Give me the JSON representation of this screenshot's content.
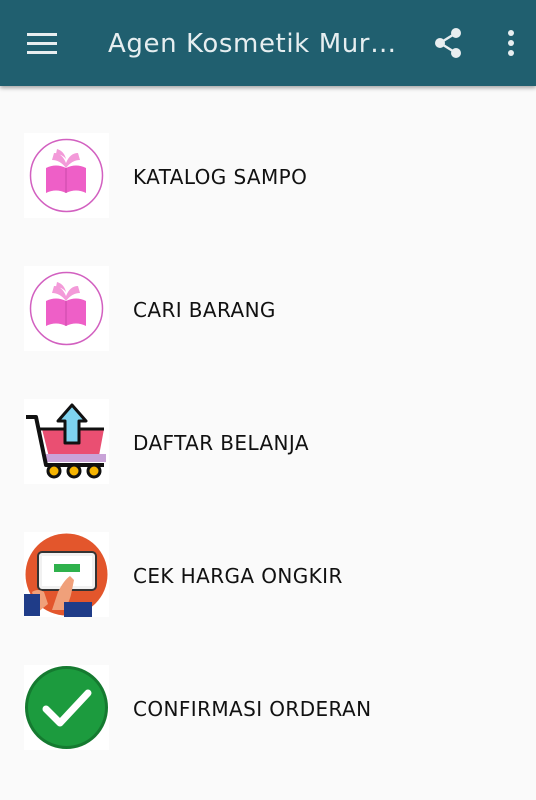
{
  "appbar": {
    "title": "Agen Kosmetik Mur…",
    "menu_icon": "hamburger-menu-icon",
    "share_icon": "share-icon",
    "more_icon": "more-vertical-icon",
    "background_color": "#205f6f"
  },
  "menu": {
    "items": [
      {
        "label": "KATALOG SAMPO",
        "icon": "pink-book-icon"
      },
      {
        "label": "CARI BARANG",
        "icon": "pink-book-icon"
      },
      {
        "label": "DAFTAR BELANJA",
        "icon": "shopping-cart-upload-icon"
      },
      {
        "label": "CEK HARGA ONGKIR",
        "icon": "tablet-touch-icon"
      },
      {
        "label": "CONFIRMASI ORDERAN",
        "icon": "green-checkmark-icon"
      }
    ]
  }
}
